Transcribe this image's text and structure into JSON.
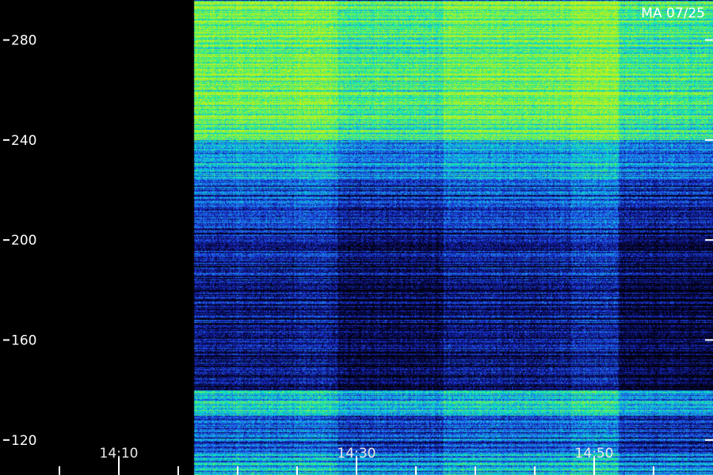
{
  "chart_data": {
    "type": "heatmap",
    "title": "",
    "xlabel": "",
    "ylabel": "",
    "stamp": "MA 07/25",
    "x_tick_labels": [
      "14:10",
      "14:30",
      "14:50"
    ],
    "y_tick_labels": [
      "280",
      "240",
      "200",
      "160",
      "120"
    ],
    "y_tick_values": [
      280,
      240,
      200,
      160,
      120
    ],
    "ylim": [
      106,
      296
    ],
    "data_region_x_start": "14:16",
    "colormap": [
      "#000000",
      "#08084a",
      "#1a2dd6",
      "#1f8cf0",
      "#00e0d0",
      "#5cf25a",
      "#c8f018"
    ],
    "colors": {
      "text": "#ffffff",
      "background": "#000000"
    },
    "bands": [
      {
        "y_range": [
          240,
          296
        ],
        "level": 0.85,
        "description": "strong"
      },
      {
        "y_range": [
          225,
          240
        ],
        "level": 0.55
      },
      {
        "y_range": [
          205,
          225
        ],
        "level": 0.38
      },
      {
        "y_range": [
          170,
          205
        ],
        "level": 0.25
      },
      {
        "y_range": [
          140,
          170
        ],
        "level": 0.22
      },
      {
        "y_range": [
          130,
          140
        ],
        "level": 0.65
      },
      {
        "y_range": [
          106,
          130
        ],
        "level": 0.4
      }
    ]
  }
}
